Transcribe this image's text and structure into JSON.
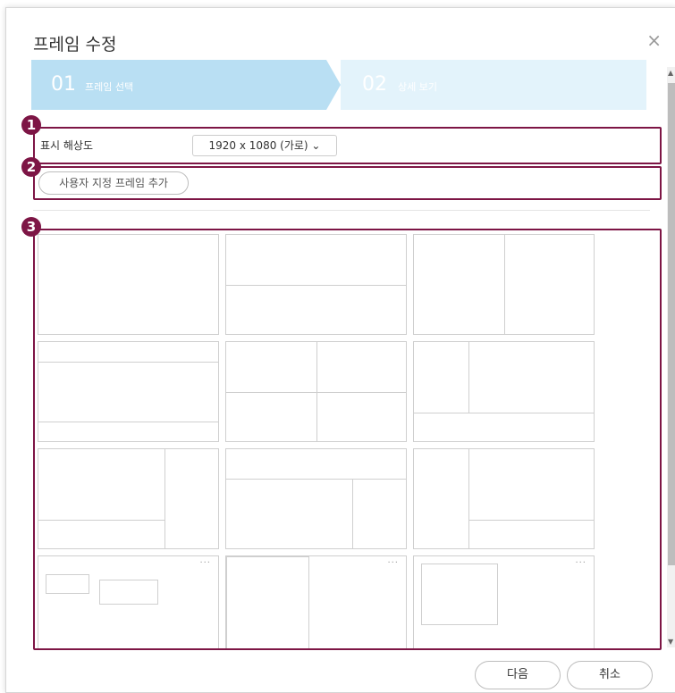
{
  "dialog": {
    "title": "프레임 수정",
    "close_symbol": "×"
  },
  "steps": [
    {
      "num": "01",
      "label": "프레임 선택"
    },
    {
      "num": "02",
      "label": "상세 보기"
    }
  ],
  "resolution": {
    "label": "표시 해상도",
    "value": "1920 x 1080 (가로) ⌄"
  },
  "add_button": "사용자 지정 프레임 추가",
  "badges": [
    "1",
    "2",
    "3"
  ],
  "more_symbol": "···",
  "footer": {
    "next": "다음",
    "cancel": "취소"
  },
  "colors": {
    "highlight": "#7d1545",
    "step_active": "#b9dff3",
    "step_inactive": "#e3f3fb"
  }
}
